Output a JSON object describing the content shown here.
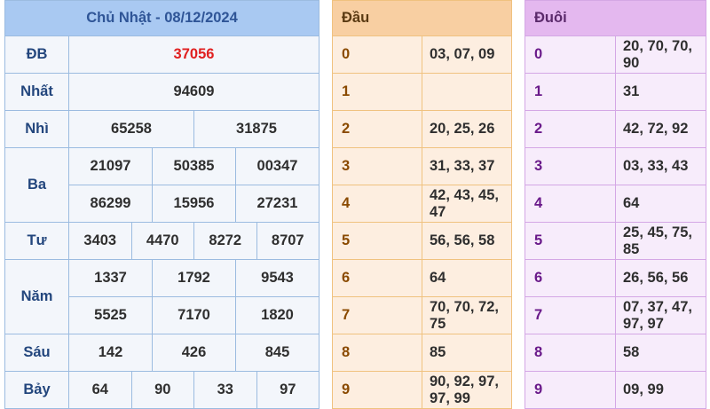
{
  "results": {
    "title": "Chủ Nhật - 08/12/2024",
    "rows": {
      "db": {
        "label": "ĐB",
        "values": [
          "37056"
        ]
      },
      "nhat": {
        "label": "Nhất",
        "values": [
          "94609"
        ]
      },
      "nhi": {
        "label": "Nhì",
        "values": [
          "65258",
          "31875"
        ]
      },
      "ba": {
        "label": "Ba",
        "values": [
          "21097",
          "50385",
          "00347",
          "86299",
          "15956",
          "27231"
        ]
      },
      "tu": {
        "label": "Tư",
        "values": [
          "3403",
          "4470",
          "8272",
          "8707"
        ]
      },
      "nam": {
        "label": "Năm",
        "values": [
          "1337",
          "1792",
          "9543",
          "5525",
          "7170",
          "1820"
        ]
      },
      "sau": {
        "label": "Sáu",
        "values": [
          "142",
          "426",
          "845"
        ]
      },
      "bay": {
        "label": "Bảy",
        "values": [
          "64",
          "90",
          "33",
          "97"
        ]
      }
    },
    "special_color": "#e02020"
  },
  "head": {
    "title": "Đầu",
    "rows": [
      {
        "digit": "0",
        "values": "03, 07, 09"
      },
      {
        "digit": "1",
        "values": ""
      },
      {
        "digit": "2",
        "values": "20, 25, 26"
      },
      {
        "digit": "3",
        "values": "31, 33, 37"
      },
      {
        "digit": "4",
        "values": "42, 43, 45, 47"
      },
      {
        "digit": "5",
        "values": "56, 56, 58"
      },
      {
        "digit": "6",
        "values": "64"
      },
      {
        "digit": "7",
        "values": "70, 70, 72, 75"
      },
      {
        "digit": "8",
        "values": "85"
      },
      {
        "digit": "9",
        "values": "90, 92, 97, 97, 99"
      }
    ]
  },
  "tail": {
    "title": "Đuôi",
    "rows": [
      {
        "digit": "0",
        "values": "20, 70, 70, 90"
      },
      {
        "digit": "1",
        "values": "31"
      },
      {
        "digit": "2",
        "values": "42, 72, 92"
      },
      {
        "digit": "3",
        "values": "03, 33, 43"
      },
      {
        "digit": "4",
        "values": "64"
      },
      {
        "digit": "5",
        "values": "25, 45, 75, 85"
      },
      {
        "digit": "6",
        "values": "26, 56, 56"
      },
      {
        "digit": "7",
        "values": "07, 37, 47, 97, 97"
      },
      {
        "digit": "8",
        "values": "58"
      },
      {
        "digit": "9",
        "values": "09, 99"
      }
    ]
  }
}
